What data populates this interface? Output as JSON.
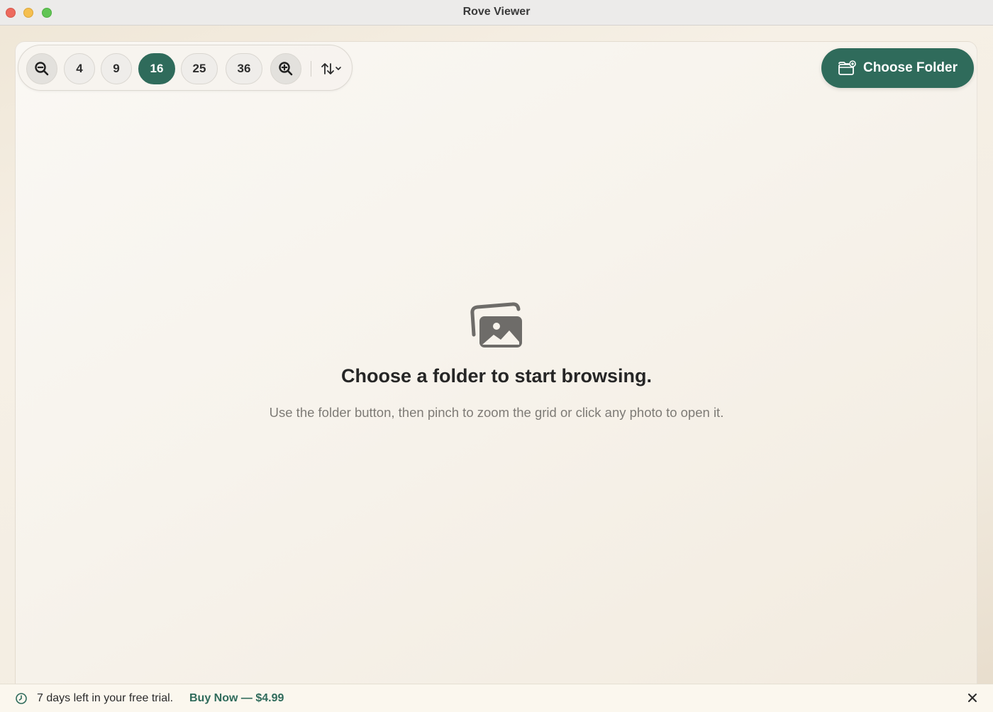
{
  "window": {
    "title": "Rove Viewer",
    "controls": [
      "close",
      "minimize",
      "zoom"
    ]
  },
  "toolbar": {
    "zoom_out_icon": "zoom-out-magnifier-icon",
    "grid_sizes": [
      "4",
      "9",
      "16",
      "25",
      "36"
    ],
    "selected_grid_size": "16",
    "zoom_in_icon": "zoom-in-magnifier-icon",
    "sort_icon": "sort-arrows-chevron-icon"
  },
  "choose_folder": {
    "label": "Choose Folder",
    "icon": "folder-add-icon"
  },
  "empty_state": {
    "icon": "photos-stack-icon",
    "title": "Choose a folder to start browsing.",
    "subtitle": "Use the folder button, then pinch to zoom the grid or click any photo to open it."
  },
  "trial_banner": {
    "icon": "clock-icon",
    "message": "7 days left in your free trial.",
    "buy_label": "Buy Now — $4.99",
    "dismiss_icon": "close-x-icon"
  },
  "colors": {
    "accent": "#2f6b5b",
    "background": "#f6f1e8"
  }
}
